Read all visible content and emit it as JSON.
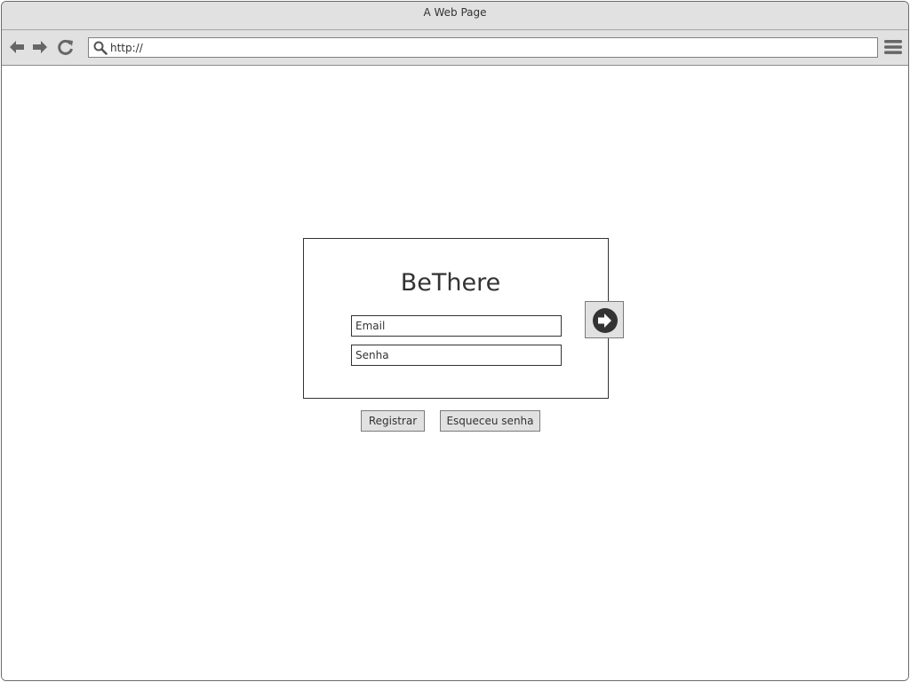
{
  "window": {
    "title": "A Web Page"
  },
  "toolbar": {
    "back_icon": "arrow-left-icon",
    "forward_icon": "arrow-right-icon",
    "reload_icon": "refresh-icon",
    "menu_icon": "hamburger-menu-icon",
    "address": {
      "icon": "search-icon",
      "value": "http://"
    }
  },
  "login": {
    "title": "BeThere",
    "email_placeholder": "Email",
    "password_placeholder": "Senha",
    "submit_icon": "arrow-circle-right-icon"
  },
  "actions": {
    "register_label": "Registrar",
    "forgot_label": "Esqueceu senha"
  },
  "colors": {
    "chrome_bg": "#e1e1e1",
    "icon": "#666666",
    "border": "#333333"
  }
}
